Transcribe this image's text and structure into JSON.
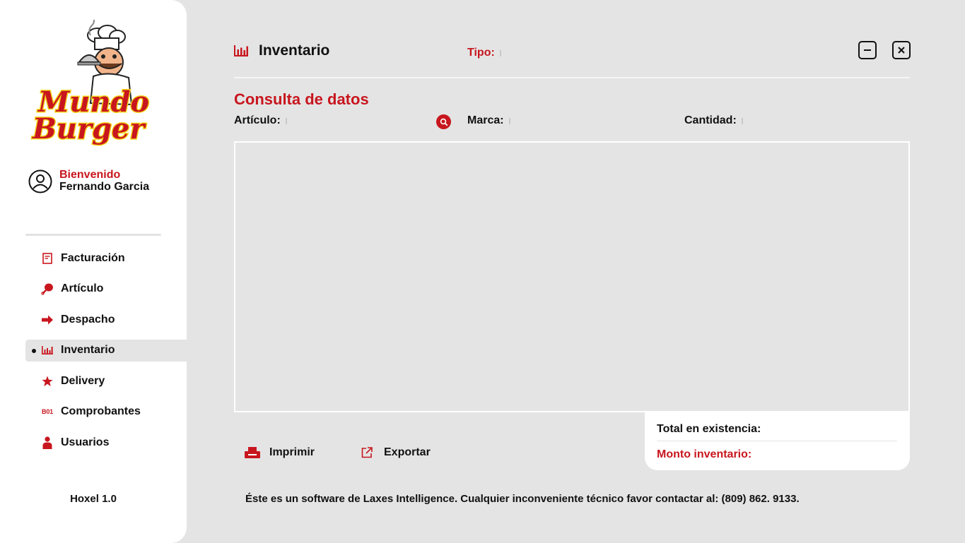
{
  "app": {
    "brand": "Mundo Burger",
    "version": "Hoxel 1.0"
  },
  "user": {
    "greeting": "Bienvenido",
    "name": "Fernando Garcia"
  },
  "sidebar": {
    "items": [
      {
        "label": "Facturación",
        "icon": "invoice-icon"
      },
      {
        "label": "Artículo",
        "icon": "drumstick-icon"
      },
      {
        "label": "Despacho",
        "icon": "arrow-right-icon"
      },
      {
        "label": "Inventario",
        "icon": "bar-chart-icon",
        "active": true
      },
      {
        "label": "Delivery",
        "icon": "star-icon"
      },
      {
        "label": "Comprobantes",
        "icon": "b01-icon",
        "icon_text": "B01"
      },
      {
        "label": "Usuarios",
        "icon": "user-icon"
      }
    ]
  },
  "header": {
    "title": "Inventario",
    "tipo_label": "Tipo:"
  },
  "query": {
    "title": "Consulta de datos",
    "articulo_label": "Artículo:",
    "marca_label": "Marca:",
    "cantidad_label": "Cantidad:"
  },
  "totals": {
    "total_existencia_label": "Total en existencia:",
    "monto_inventario_label": "Monto inventario:"
  },
  "actions": {
    "print_label": "Imprimir",
    "export_label": "Exportar"
  },
  "footer": {
    "text": "Éste es un software de Laxes Intelligence. Cualquier inconveniente técnico favor contactar al:  (809) 862. 9133."
  },
  "colors": {
    "accent": "#c8161e",
    "background": "#e4e4e4",
    "panel": "#ffffff",
    "text": "#111111"
  }
}
